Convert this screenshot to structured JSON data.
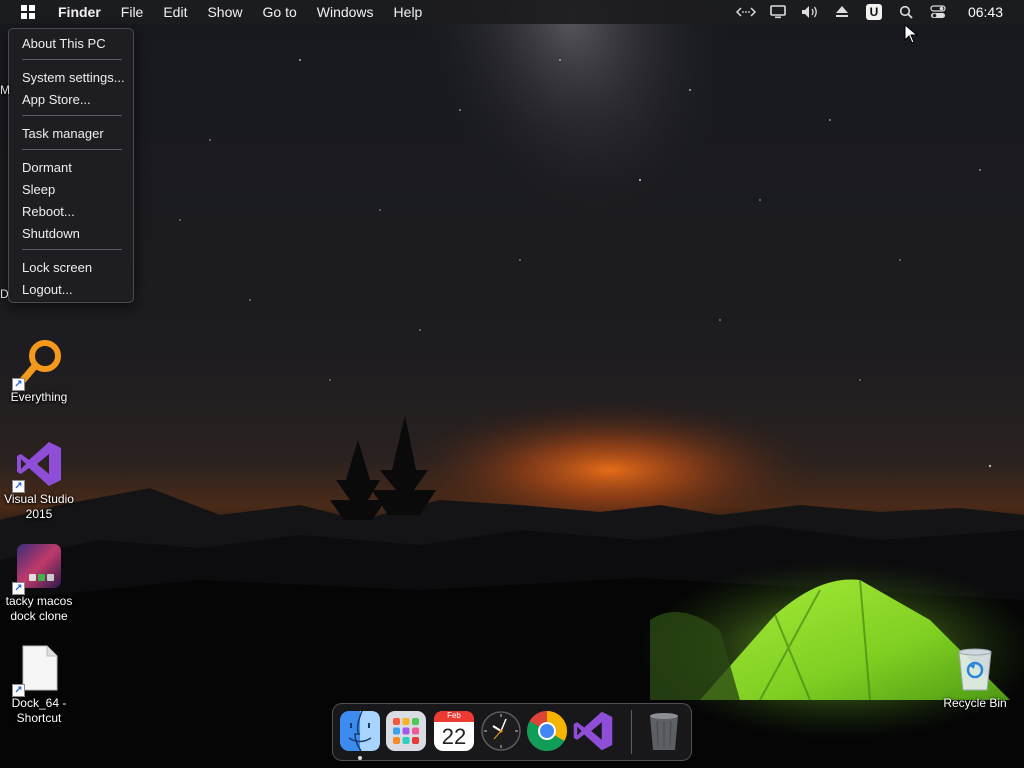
{
  "menubar": {
    "app_name": "Finder",
    "menus": [
      "File",
      "Edit",
      "Show",
      "Go to",
      "Windows",
      "Help"
    ],
    "status_icons": [
      "remote-desktop-icon",
      "monitor-icon",
      "volume-icon",
      "eject-icon",
      "u-app-icon",
      "search-icon",
      "control-center-icon"
    ],
    "u_app_letter": "U",
    "clock": "06:43"
  },
  "dropdown": {
    "items": [
      "About This PC",
      "System settings...",
      "App Store...",
      "Task manager",
      "Dormant",
      "Sleep",
      "Reboot...",
      "Shutdown",
      "Lock screen",
      "Logout..."
    ]
  },
  "desktop": {
    "partial_labels": [
      "M",
      "D"
    ],
    "icons": [
      {
        "label": "Everything",
        "icon": "everything-search-icon"
      },
      {
        "label": "Visual Studio 2015",
        "icon": "visual-studio-icon"
      },
      {
        "label": "tacky macos dock clone",
        "icon": "dock-clone-icon"
      },
      {
        "label": "Dock_64 - Shortcut",
        "icon": "file-icon"
      },
      {
        "label": "Recycle Bin",
        "icon": "recycle-bin-icon"
      }
    ]
  },
  "dock": {
    "apps": [
      "finder-icon",
      "launchpad-icon",
      "calendar-icon",
      "clock-icon",
      "chrome-icon",
      "visual-studio-icon",
      "trash-icon"
    ],
    "calendar_month": "Feb",
    "calendar_day": "22"
  },
  "colors": {
    "everything_orange": "#f39a1c",
    "visual_studio_purple": "#8f4ed8",
    "tent_green": "#8fdc2a",
    "horizon_glow": "#e05a10"
  }
}
